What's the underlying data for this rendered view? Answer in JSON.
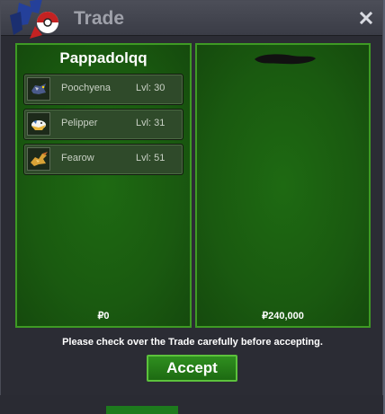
{
  "window": {
    "title": "Trade"
  },
  "left_panel": {
    "trainer_name": "Pappadolqq",
    "pokemon": [
      {
        "name": "Poochyena",
        "level": "Lvl: 30",
        "icon": "poochyena-icon"
      },
      {
        "name": "Pelipper",
        "level": "Lvl: 31",
        "icon": "pelipper-icon"
      },
      {
        "name": "Fearow",
        "level": "Lvl: 51",
        "icon": "fearow-icon"
      }
    ],
    "money": "₽0"
  },
  "right_panel": {
    "trainer_name_redacted": true,
    "money": "₽240,000"
  },
  "notice": "Please check over the Trade carefully before accepting.",
  "accept_label": "Accept",
  "colors": {
    "panel_green": "#1e6a12",
    "panel_border": "#3e9a24",
    "window_bg": "#2b2c34"
  }
}
